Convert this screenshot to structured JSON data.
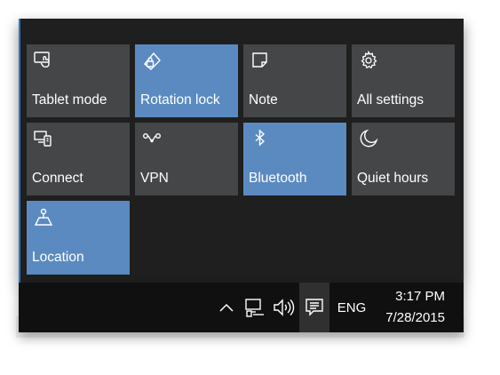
{
  "tiles": [
    {
      "label": "Tablet mode",
      "icon": "tablet-mode-icon",
      "active": false
    },
    {
      "label": "Rotation lock",
      "icon": "rotation-lock-icon",
      "active": true
    },
    {
      "label": "Note",
      "icon": "note-icon",
      "active": false
    },
    {
      "label": "All settings",
      "icon": "gear-icon",
      "active": false
    },
    {
      "label": "Connect",
      "icon": "connect-icon",
      "active": false
    },
    {
      "label": "VPN",
      "icon": "vpn-icon",
      "active": false
    },
    {
      "label": "Bluetooth",
      "icon": "bluetooth-icon",
      "active": true
    },
    {
      "label": "Quiet hours",
      "icon": "moon-icon",
      "active": false
    },
    {
      "label": "Location",
      "icon": "location-icon",
      "active": true
    }
  ],
  "taskbar": {
    "tray_icons": [
      "chevron-up-icon",
      "network-icon",
      "volume-icon",
      "action-center-icon"
    ],
    "language": "ENG",
    "time": "3:17 PM",
    "date": "7/28/2015"
  },
  "colors": {
    "tile_off": "#454648",
    "tile_on": "#5b8ac0",
    "panel_bg": "#1f1f1f",
    "taskbar_bg": "#101010"
  }
}
